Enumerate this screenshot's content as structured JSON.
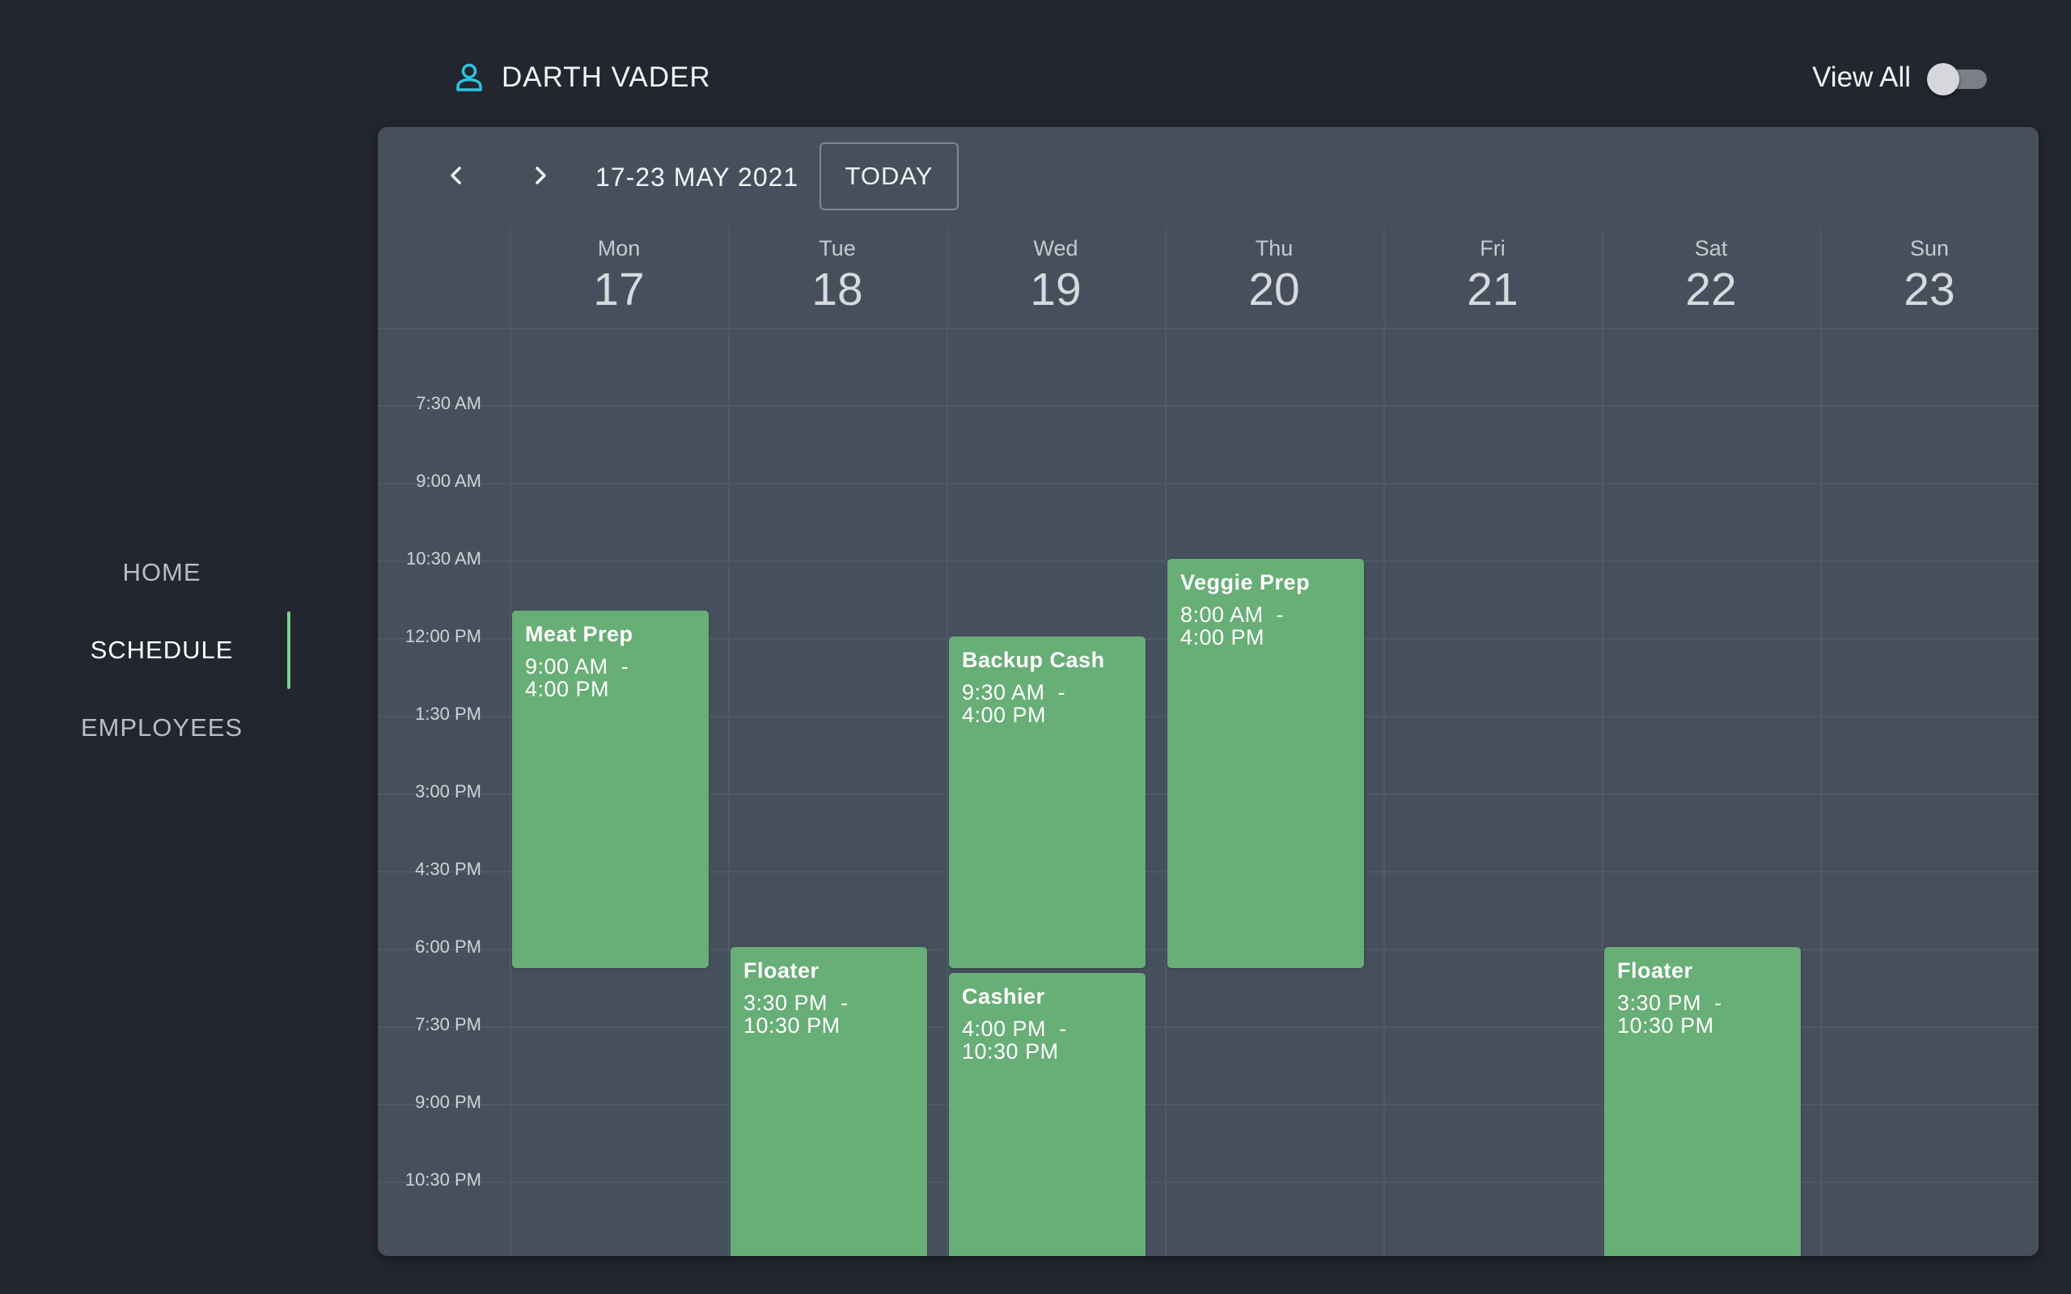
{
  "nav": {
    "items": [
      {
        "label": "HOME"
      },
      {
        "label": "SCHEDULE"
      },
      {
        "label": "EMPLOYEES"
      }
    ],
    "active": "SCHEDULE",
    "accent_color": "#7bd08e"
  },
  "header": {
    "user_icon": "person-icon",
    "user_name": "DARTH VADER",
    "view_all_label": "View All",
    "view_all_on": false
  },
  "calendar": {
    "prev_icon": "chevron-left-icon",
    "next_icon": "chevron-right-icon",
    "date_range": "17-23 MAY 2021",
    "today_label": "TODAY",
    "days": [
      {
        "name": "Mon",
        "num": "17"
      },
      {
        "name": "Tue",
        "num": "18"
      },
      {
        "name": "Wed",
        "num": "19"
      },
      {
        "name": "Thu",
        "num": "20"
      },
      {
        "name": "Fri",
        "num": "21"
      },
      {
        "name": "Sat",
        "num": "22"
      },
      {
        "name": "Sun",
        "num": "23"
      }
    ],
    "times": [
      "7:30 AM",
      "9:00 AM",
      "10:30 AM",
      "12:00 PM",
      "1:30 PM",
      "3:00 PM",
      "4:30 PM",
      "6:00 PM",
      "7:30 PM",
      "9:00 PM",
      "10:30 PM"
    ],
    "event_color": "#68ae77",
    "events": [
      {
        "day": 0,
        "title": "Meat Prep",
        "start": "9:00 AM",
        "end": "4:00 PM"
      },
      {
        "day": 1,
        "title": "Floater",
        "start": "3:30 PM",
        "end": "10:30 PM"
      },
      {
        "day": 2,
        "title": "Backup Cash",
        "start": "9:30 AM",
        "end": "4:00 PM"
      },
      {
        "day": 2,
        "title": "Cashier",
        "start": "4:00 PM",
        "end": "10:30 PM"
      },
      {
        "day": 3,
        "title": "Veggie Prep",
        "start": "8:00 AM",
        "end": "4:00 PM"
      },
      {
        "day": 5,
        "title": "Floater",
        "start": "3:30 PM",
        "end": "10:30 PM"
      }
    ]
  }
}
